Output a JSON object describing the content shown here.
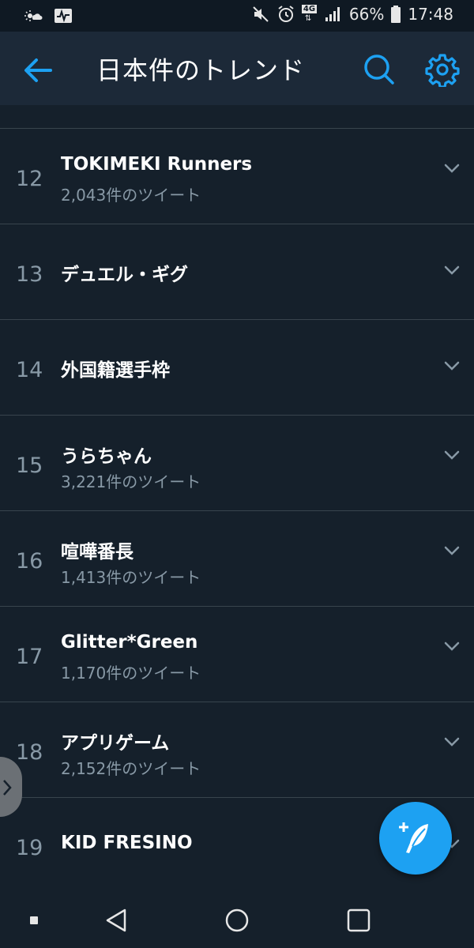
{
  "status_bar": {
    "battery": "66%",
    "time": "17:48",
    "network": "4G",
    "icons": [
      "weather-icon",
      "activity-icon",
      "mute-icon",
      "alarm-icon",
      "network-4g-icon",
      "signal-icon",
      "battery-icon"
    ]
  },
  "header": {
    "title": "日本件のトレンド",
    "icons": [
      "back-arrow-icon",
      "search-icon",
      "gear-icon"
    ],
    "accent_color": "#1da1f2"
  },
  "trends": [
    {
      "rank": "12",
      "name": "TOKIMEKI Runners",
      "count": "2,043件のツイート"
    },
    {
      "rank": "13",
      "name": "デュエル・ギグ",
      "count": ""
    },
    {
      "rank": "14",
      "name": "外国籍選手枠",
      "count": ""
    },
    {
      "rank": "15",
      "name": "うらちゃん",
      "count": "3,221件のツイート"
    },
    {
      "rank": "16",
      "name": "喧嘩番長",
      "count": "1,413件のツイート"
    },
    {
      "rank": "17",
      "name": "Glitter*Green",
      "count": "1,170件のツイート"
    },
    {
      "rank": "18",
      "name": "アプリゲーム",
      "count": "2,152件のツイート"
    },
    {
      "rank": "19",
      "name": "KID FRESINO",
      "count": ""
    }
  ],
  "fab": {
    "icon": "compose-tweet-icon"
  },
  "nav_bar": {
    "icons": [
      "nav-square-dot-icon",
      "nav-back-icon",
      "nav-home-icon",
      "nav-recent-icon"
    ]
  },
  "colors": {
    "background": "#15202b",
    "header": "#1c2938",
    "divider": "#38444d",
    "muted_text": "#8899a6",
    "accent": "#1da1f2"
  }
}
